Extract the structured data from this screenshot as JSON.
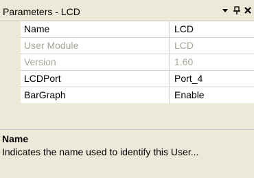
{
  "panel": {
    "title": "Parameters - LCD",
    "buttons": {
      "dropdown_icon": "triangle-down",
      "pin_icon": "pushpin",
      "close_icon": "close-x"
    }
  },
  "properties": {
    "rows": [
      {
        "name": "Name",
        "value": "LCD",
        "enabled": true
      },
      {
        "name": "User Module",
        "value": "LCD",
        "enabled": false
      },
      {
        "name": "Version",
        "value": "1.60",
        "enabled": false
      },
      {
        "name": "LCDPort",
        "value": "Port_4",
        "enabled": true
      },
      {
        "name": "BarGraph",
        "value": "Enable",
        "enabled": true
      }
    ]
  },
  "description": {
    "title": "Name",
    "text": "Indicates the name used to identify this User..."
  },
  "colors": {
    "panel_background": "#ece9d8",
    "grid_background": "#ffffff",
    "disabled_text": "#a8a596"
  }
}
